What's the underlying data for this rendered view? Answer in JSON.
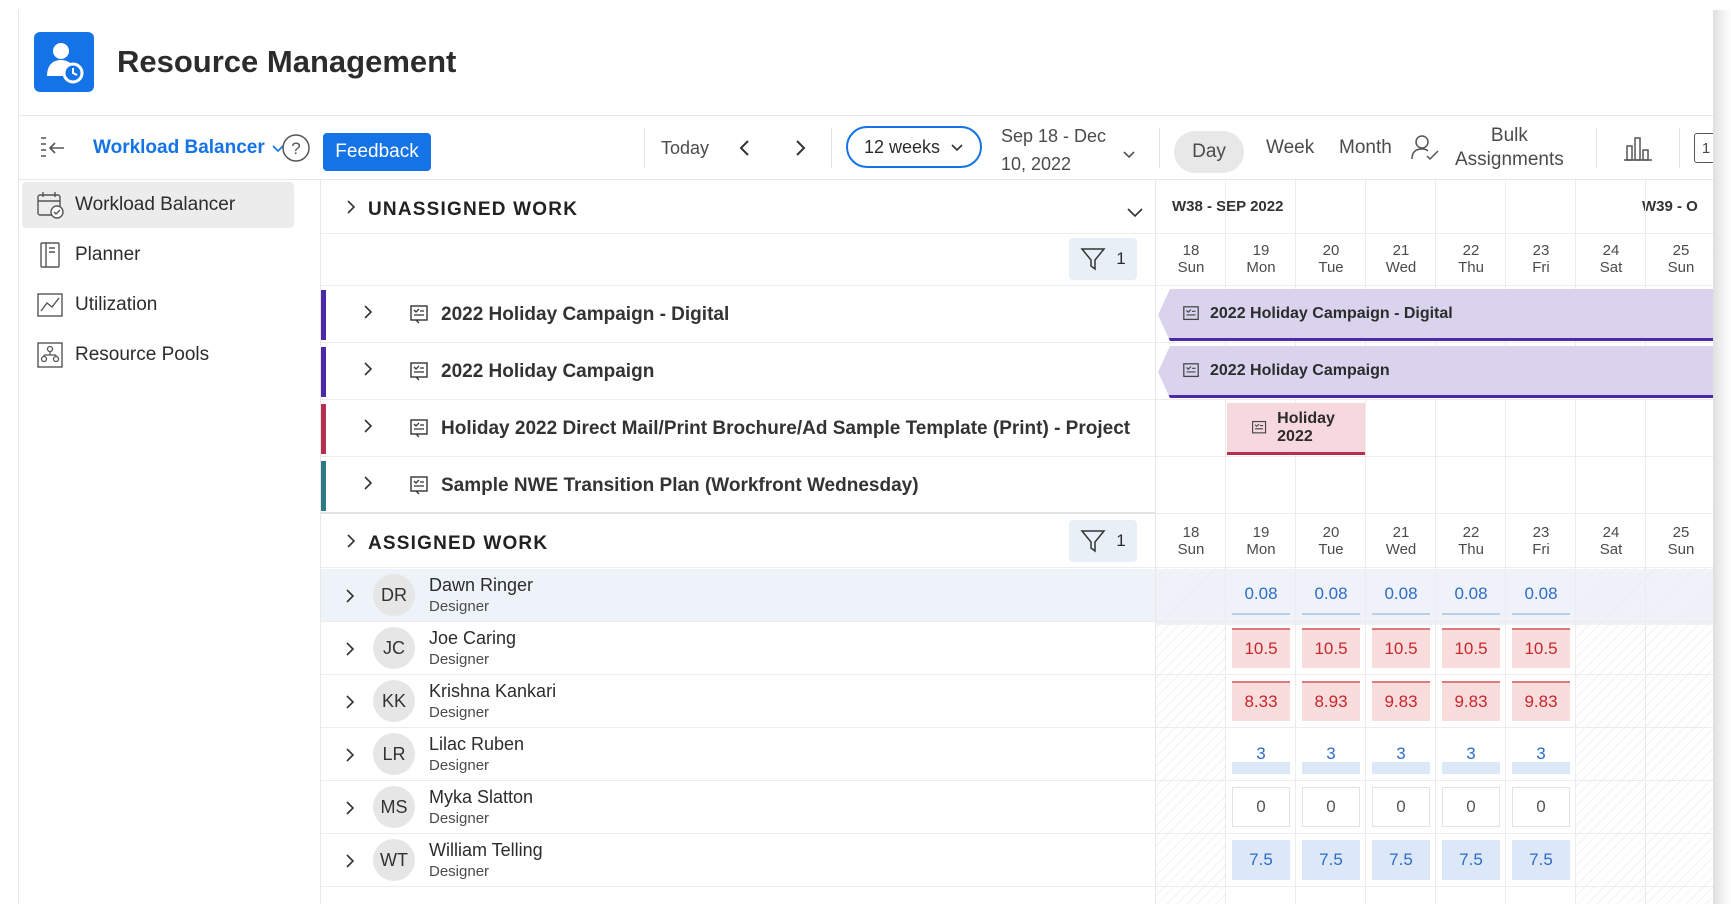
{
  "app": {
    "title": "Resource Management",
    "icon": "person-clock-icon"
  },
  "toolbar": {
    "view_name": "Workload Balancer",
    "feedback": "Feedback",
    "today": "Today",
    "weeks": "12 weeks",
    "date_range_line1": "Sep 18 - Dec",
    "date_range_line2": "10, 2022",
    "day": "Day",
    "week": "Week",
    "month": "Month",
    "bulk_line1": "Bulk",
    "bulk_line2": "Assignments",
    "overflow_label": "1"
  },
  "sidebar": {
    "items": [
      {
        "label": "Workload Balancer",
        "icon": "calendar-check-icon"
      },
      {
        "label": "Planner",
        "icon": "planner-icon"
      },
      {
        "label": "Utilization",
        "icon": "line-chart-icon"
      },
      {
        "label": "Resource Pools",
        "icon": "org-chart-icon"
      }
    ]
  },
  "unassigned": {
    "title": "UNASSIGNED WORK",
    "filter_count": "1",
    "week_label": "W38 - SEP 2022",
    "next_week_label": "W39 - O",
    "projects": [
      {
        "name": "2022 Holiday Campaign - Digital",
        "color": "#4b2aa8"
      },
      {
        "name": "2022 Holiday Campaign",
        "color": "#4b2aa8"
      },
      {
        "name": "Holiday 2022 Direct Mail/Print Brochure/Ad Sample Template (Print) - Project",
        "color": "#b4304f"
      },
      {
        "name": "Sample NWE Transition Plan (Workfront Wednesday)",
        "color": "#2d7a82"
      }
    ],
    "gantt": [
      {
        "label": "2022 Holiday Campaign - Digital"
      },
      {
        "label": "2022 Holiday Campaign"
      },
      {
        "label": "Holiday 2022"
      }
    ]
  },
  "days": [
    {
      "num": "18",
      "dow": "Sun"
    },
    {
      "num": "19",
      "dow": "Mon"
    },
    {
      "num": "20",
      "dow": "Tue"
    },
    {
      "num": "21",
      "dow": "Wed"
    },
    {
      "num": "22",
      "dow": "Thu"
    },
    {
      "num": "23",
      "dow": "Fri"
    },
    {
      "num": "24",
      "dow": "Sat"
    },
    {
      "num": "25",
      "dow": "Sun"
    }
  ],
  "assigned": {
    "title": "ASSIGNED WORK",
    "filter_count": "1",
    "people": [
      {
        "initials": "DR",
        "name": "Dawn Ringer",
        "role": "Designer",
        "style": "blue",
        "hours": [
          "0.08",
          "0.08",
          "0.08",
          "0.08",
          "0.08"
        ]
      },
      {
        "initials": "JC",
        "name": "Joe Caring",
        "role": "Designer",
        "style": "red",
        "hours": [
          "10.5",
          "10.5",
          "10.5",
          "10.5",
          "10.5"
        ]
      },
      {
        "initials": "KK",
        "name": "Krishna Kankari",
        "role": "Designer",
        "style": "red",
        "hours": [
          "8.33",
          "8.93",
          "9.83",
          "9.83",
          "9.83"
        ]
      },
      {
        "initials": "LR",
        "name": "Lilac Ruben",
        "role": "Designer",
        "style": "lblue",
        "hours": [
          "3",
          "3",
          "3",
          "3",
          "3"
        ]
      },
      {
        "initials": "MS",
        "name": "Myka Slatton",
        "role": "Designer",
        "style": "zero",
        "hours": [
          "0",
          "0",
          "0",
          "0",
          "0"
        ]
      },
      {
        "initials": "WT",
        "name": "William Telling",
        "role": "Designer",
        "style": "teal",
        "hours": [
          "7.5",
          "7.5",
          "7.5",
          "7.5",
          "7.5"
        ]
      }
    ]
  }
}
